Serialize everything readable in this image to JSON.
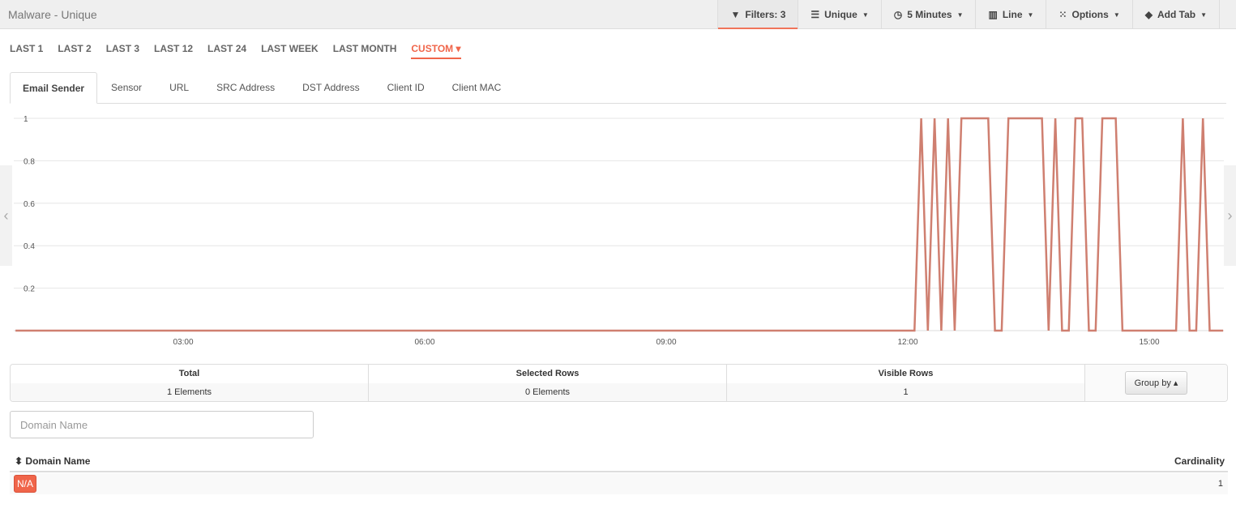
{
  "header": {
    "title": "Malware - Unique"
  },
  "toolbar": [
    {
      "icon": "filter-icon",
      "glyph": "▼",
      "label": "Filters: 3",
      "active": true,
      "caret": false
    },
    {
      "icon": "list-icon",
      "glyph": "☰",
      "label": "Unique",
      "caret": true
    },
    {
      "icon": "clock-icon",
      "glyph": "◷",
      "label": "5 Minutes",
      "caret": true
    },
    {
      "icon": "bar-chart-icon",
      "glyph": "▥",
      "label": "Line",
      "caret": true
    },
    {
      "icon": "grid-icon",
      "glyph": "⁙",
      "label": "Options",
      "caret": true
    },
    {
      "icon": "tag-icon",
      "glyph": "◆",
      "label": "Add Tab",
      "caret": true
    }
  ],
  "ranges": [
    "LAST 1",
    "LAST 2",
    "LAST 3",
    "LAST 12",
    "LAST 24",
    "LAST WEEK",
    "LAST MONTH",
    "CUSTOM ▾"
  ],
  "selected_range": "CUSTOM ▾",
  "tabs": [
    "Email Sender",
    "Sensor",
    "URL",
    "SRC Address",
    "DST Address",
    "Client ID",
    "Client MAC"
  ],
  "selected_tab": "Email Sender",
  "chart_data": {
    "type": "line",
    "color": "#cf7f70",
    "ylim": [
      0,
      1
    ],
    "yticks": [
      "0.2",
      "0.4",
      "0.6",
      "0.8",
      "1"
    ],
    "xticks": [
      "03:00",
      "06:00",
      "09:00",
      "12:00",
      "15:00"
    ],
    "xlim": [
      "00:55",
      "15:55"
    ],
    "grid": true,
    "series": [
      {
        "points": [
          [
            "00:55",
            0
          ],
          [
            "12:05",
            0
          ],
          [
            "12:10",
            1
          ],
          [
            "12:15",
            0
          ],
          [
            "12:20",
            1
          ],
          [
            "12:25",
            0
          ],
          [
            "12:30",
            1
          ],
          [
            "12:35",
            0
          ],
          [
            "12:40",
            1
          ],
          [
            "13:00",
            1
          ],
          [
            "13:05",
            0
          ],
          [
            "13:10",
            0
          ],
          [
            "13:15",
            1
          ],
          [
            "13:40",
            1
          ],
          [
            "13:45",
            0
          ],
          [
            "13:50",
            1
          ],
          [
            "13:55",
            0
          ],
          [
            "14:00",
            0
          ],
          [
            "14:05",
            1
          ],
          [
            "14:10",
            1
          ],
          [
            "14:15",
            0
          ],
          [
            "14:20",
            0
          ],
          [
            "14:25",
            1
          ],
          [
            "14:35",
            1
          ],
          [
            "14:40",
            0
          ],
          [
            "15:20",
            0
          ],
          [
            "15:25",
            1
          ],
          [
            "15:30",
            0
          ],
          [
            "15:35",
            0
          ],
          [
            "15:40",
            1
          ],
          [
            "15:45",
            0
          ],
          [
            "15:55",
            0
          ]
        ]
      }
    ]
  },
  "stats": {
    "total": {
      "label": "Total",
      "value": "1 Elements"
    },
    "selected": {
      "label": "Selected Rows",
      "value": "0 Elements"
    },
    "visible": {
      "label": "Visible Rows",
      "value": "1"
    },
    "group_by": "Group by ▴"
  },
  "search": {
    "placeholder": "Domain Name",
    "value": ""
  },
  "table": {
    "columns": [
      "Domain Name",
      "Cardinality"
    ],
    "sort_glyph": "⬍",
    "rows": [
      {
        "domain": "N/A",
        "cardinality": "1"
      }
    ]
  }
}
